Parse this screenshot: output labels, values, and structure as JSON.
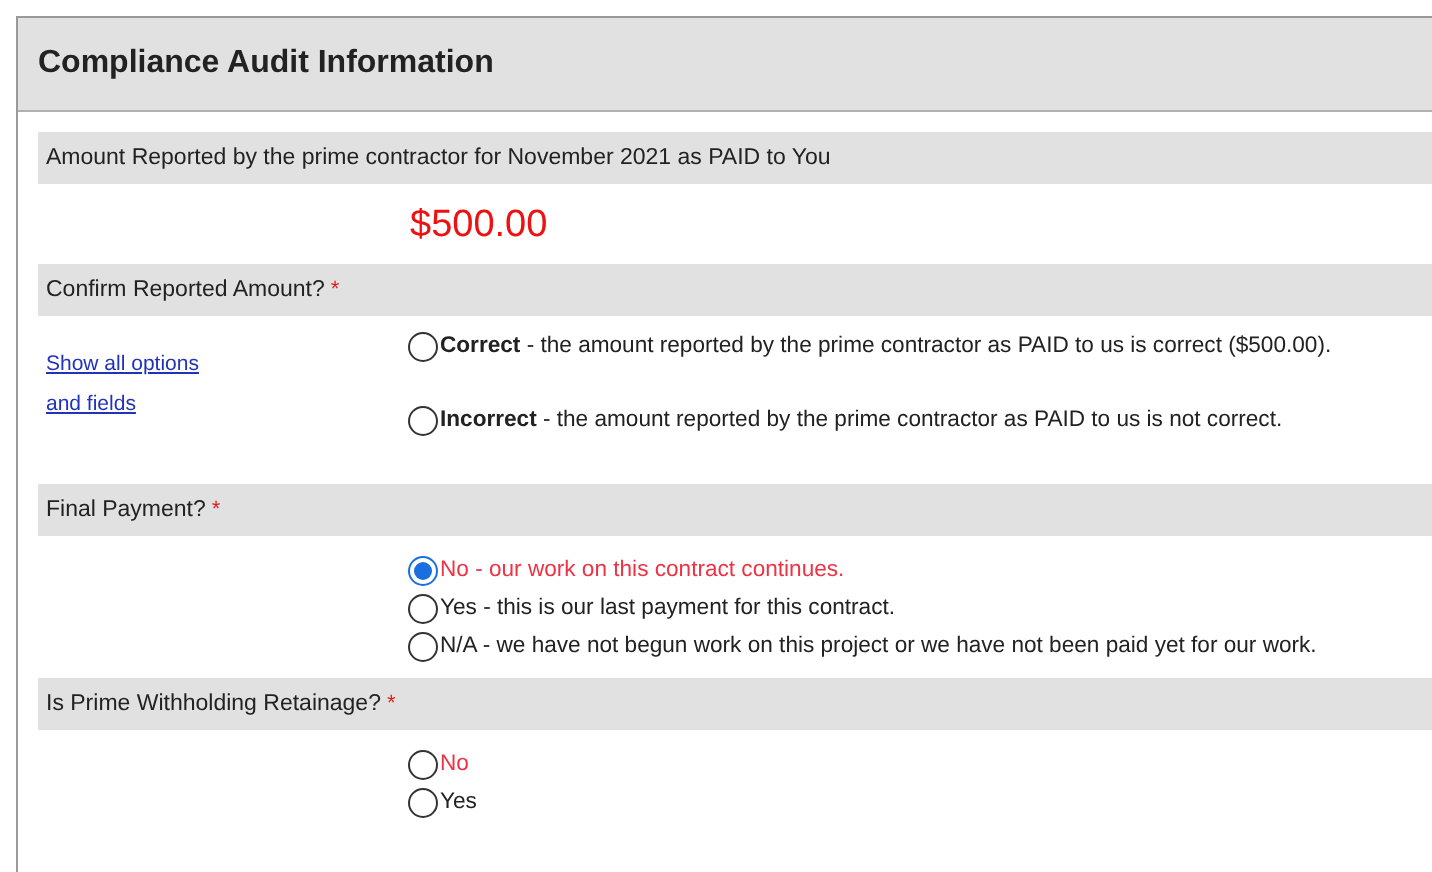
{
  "panel": {
    "title": "Compliance Audit Information"
  },
  "amount_section": {
    "label": "Amount Reported by the prime contractor for November 2021 as PAID to You",
    "amount": "$500.00"
  },
  "questions": [
    {
      "label": "Confirm Reported Amount?",
      "required_mark": "*",
      "link": "Show all options and fields",
      "options": [
        {
          "text": "**Correct** - the amount reported by the prime contractor as PAID to us is correct ($500.00).",
          "selected": false,
          "highlighted": false
        },
        {
          "text": "**Incorrect** - the amount reported by the prime contractor as PAID to us is not correct.",
          "selected": false,
          "highlighted": false
        }
      ]
    },
    {
      "label": "Final Payment?",
      "required_mark": "*",
      "options": [
        {
          "text": "No - our work on this contract continues.",
          "selected": true,
          "highlighted": true
        },
        {
          "text": "Yes - this is our last payment for this contract.",
          "selected": false,
          "highlighted": false
        },
        {
          "text": "N/A - we have not begun work on this project or we have not been paid yet for our work.",
          "selected": false,
          "highlighted": false
        }
      ]
    },
    {
      "label": "Is Prime Withholding Retainage?",
      "required_mark": "*",
      "options": [
        {
          "text": "No",
          "selected": false,
          "highlighted": true
        },
        {
          "text": "Yes",
          "selected": false,
          "highlighted": false
        }
      ]
    }
  ]
}
